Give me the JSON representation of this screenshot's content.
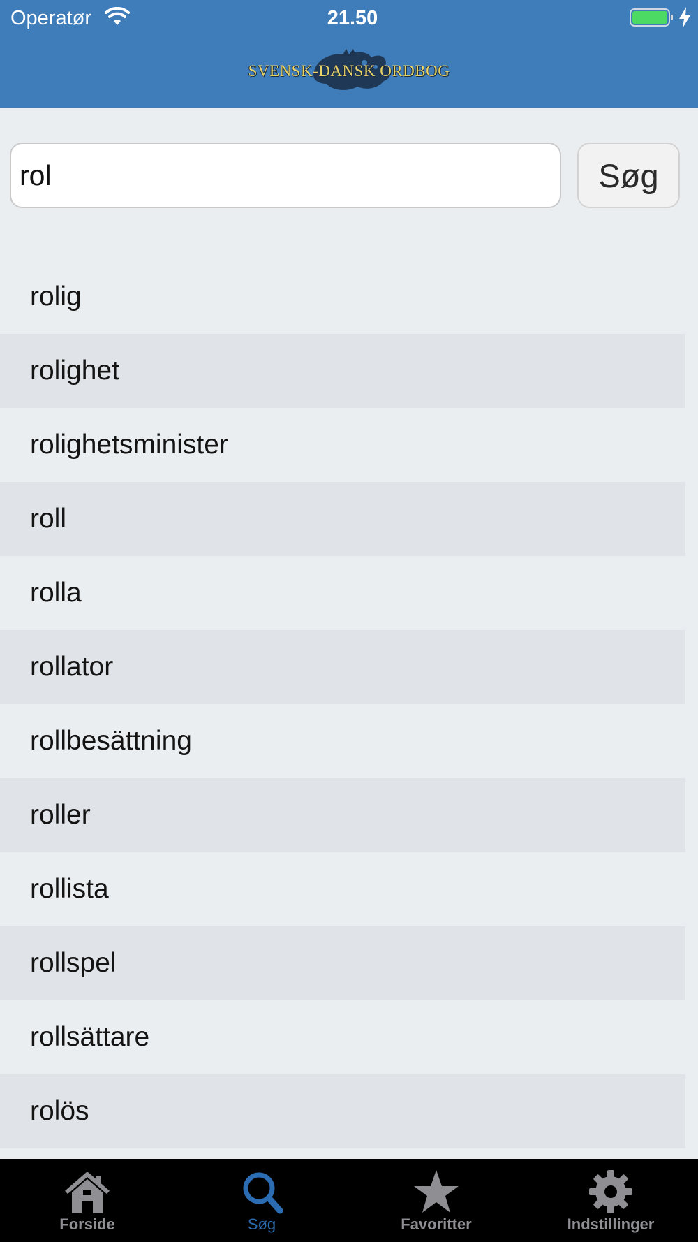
{
  "status_bar": {
    "carrier": "Operatør",
    "time": "21.50"
  },
  "header": {
    "logo_text": "SVENSK-DANSK ORDBOG"
  },
  "search": {
    "value": "rol",
    "button_label": "Søg"
  },
  "results": [
    "rolig",
    "rolighet",
    "rolighetsminister",
    "roll",
    "rolla",
    "rollator",
    "rollbesättning",
    "roller",
    "rollista",
    "rollspel",
    "rollsättare",
    "rolös"
  ],
  "tabs": [
    {
      "label": "Forside",
      "icon": "home-icon",
      "active": false
    },
    {
      "label": "Søg",
      "icon": "search-icon",
      "active": true
    },
    {
      "label": "Favoritter",
      "icon": "star-icon",
      "active": false
    },
    {
      "label": "Indstillinger",
      "icon": "gear-icon",
      "active": false
    }
  ],
  "colors": {
    "header_bg": "#3e7cba",
    "active_tab": "#2b6cb3",
    "inactive_tab": "#8e8e93",
    "battery_fill": "#4cd964"
  }
}
